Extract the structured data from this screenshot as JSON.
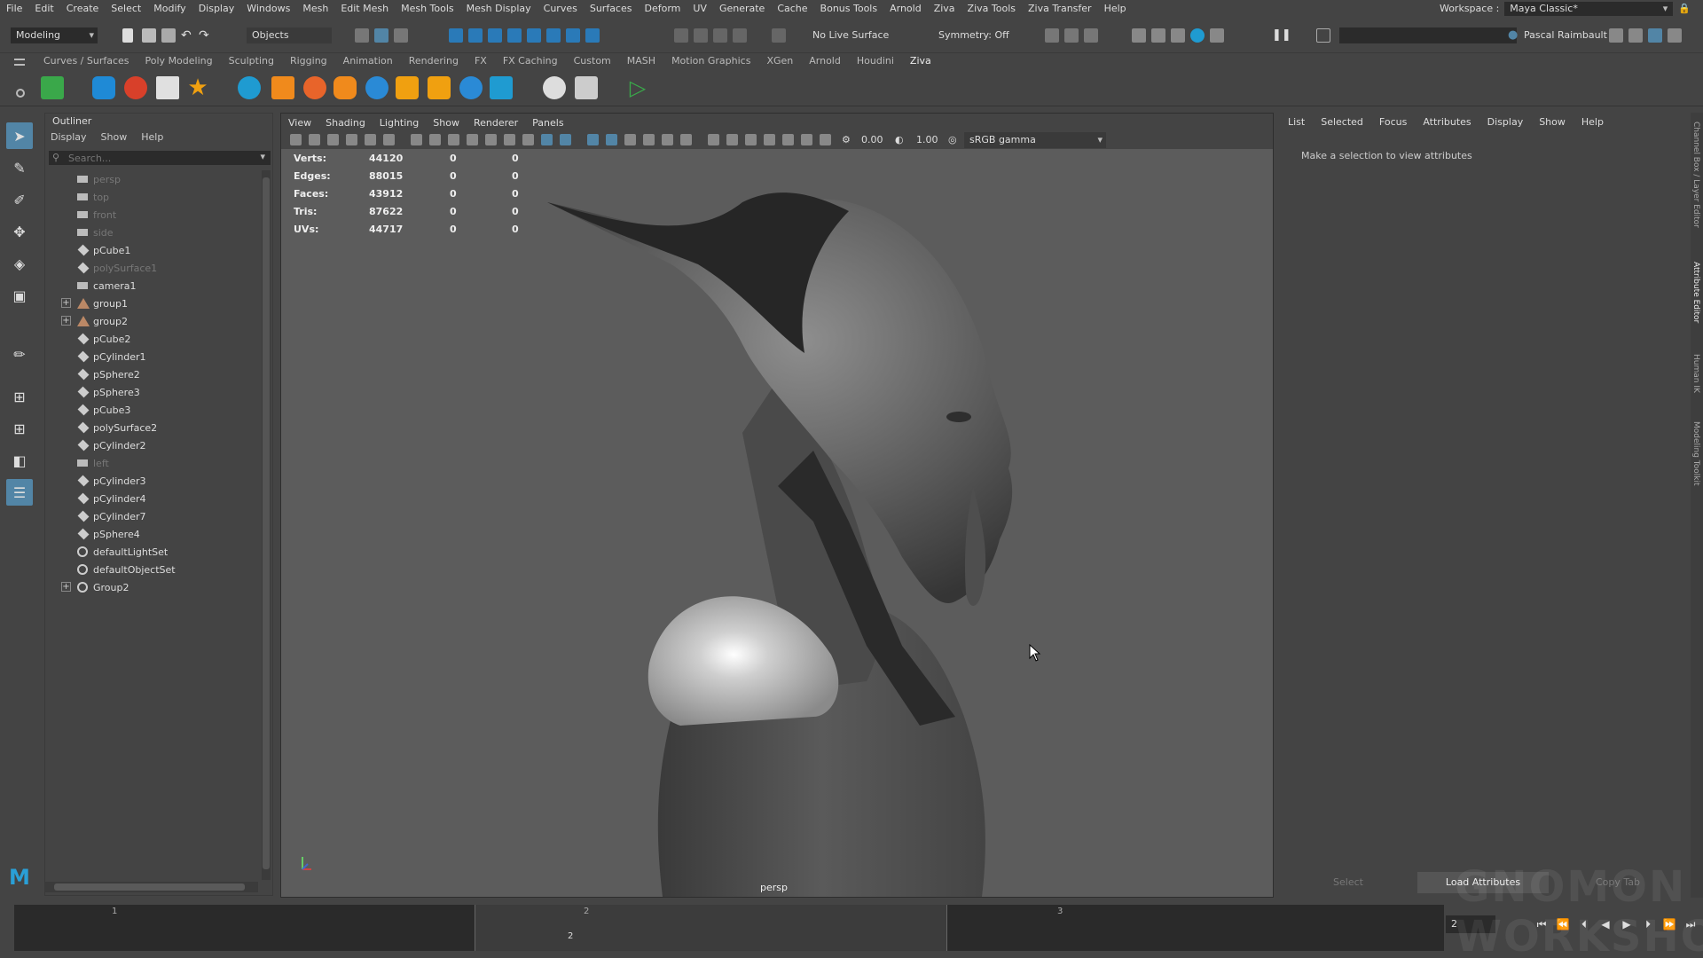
{
  "menubar": [
    "File",
    "Edit",
    "Create",
    "Select",
    "Modify",
    "Display",
    "Windows",
    "Mesh",
    "Edit Mesh",
    "Mesh Tools",
    "Mesh Display",
    "Curves",
    "Surfaces",
    "Deform",
    "UV",
    "Generate",
    "Cache",
    "Bonus Tools",
    "Arnold",
    "Ziva",
    "Ziva Tools",
    "Ziva Transfer",
    "Help"
  ],
  "workspace": {
    "label": "Workspace :",
    "value": "Maya Classic*"
  },
  "statusline": {
    "mode": "Modeling",
    "objects": "Objects",
    "live_surface": "No Live Surface",
    "symmetry": "Symmetry: Off",
    "user": "Pascal Raimbault"
  },
  "shelf_tabs": [
    "Curves / Surfaces",
    "Poly Modeling",
    "Sculpting",
    "Rigging",
    "Animation",
    "Rendering",
    "FX",
    "FX Caching",
    "Custom",
    "MASH",
    "Motion Graphics",
    "XGen",
    "Arnold",
    "Houdini",
    "Ziva"
  ],
  "active_shelf": "Ziva",
  "outliner": {
    "title": "Outliner",
    "menus": [
      "Display",
      "Show",
      "Help"
    ],
    "search_placeholder": "Search...",
    "items": [
      {
        "label": "persp",
        "icon": "camera-icon",
        "dim": true,
        "exp": false
      },
      {
        "label": "top",
        "icon": "camera-icon",
        "dim": true,
        "exp": false
      },
      {
        "label": "front",
        "icon": "camera-icon",
        "dim": true,
        "exp": false
      },
      {
        "label": "side",
        "icon": "camera-icon",
        "dim": true,
        "exp": false
      },
      {
        "label": "pCube1",
        "icon": "mesh-icon",
        "dim": false,
        "exp": false
      },
      {
        "label": "polySurface1",
        "icon": "mesh-icon",
        "dim": true,
        "exp": false
      },
      {
        "label": "camera1",
        "icon": "camera-icon",
        "dim": false,
        "exp": false
      },
      {
        "label": "group1",
        "icon": "group-icon",
        "dim": false,
        "exp": true
      },
      {
        "label": "group2",
        "icon": "group-icon",
        "dim": false,
        "exp": true
      },
      {
        "label": "pCube2",
        "icon": "mesh-icon",
        "dim": false,
        "exp": false
      },
      {
        "label": "pCylinder1",
        "icon": "mesh-icon",
        "dim": false,
        "exp": false
      },
      {
        "label": "pSphere2",
        "icon": "mesh-icon",
        "dim": false,
        "exp": false
      },
      {
        "label": "pSphere3",
        "icon": "mesh-icon",
        "dim": false,
        "exp": false
      },
      {
        "label": "pCube3",
        "icon": "mesh-icon",
        "dim": false,
        "exp": false
      },
      {
        "label": "polySurface2",
        "icon": "mesh-icon",
        "dim": false,
        "exp": false
      },
      {
        "label": "pCylinder2",
        "icon": "mesh-icon",
        "dim": false,
        "exp": false
      },
      {
        "label": "left",
        "icon": "camera-icon",
        "dim": true,
        "exp": false
      },
      {
        "label": "pCylinder3",
        "icon": "mesh-icon",
        "dim": false,
        "exp": false
      },
      {
        "label": "pCylinder4",
        "icon": "mesh-icon",
        "dim": false,
        "exp": false
      },
      {
        "label": "pCylinder7",
        "icon": "mesh-icon",
        "dim": false,
        "exp": false
      },
      {
        "label": "pSphere4",
        "icon": "mesh-icon",
        "dim": false,
        "exp": false
      },
      {
        "label": "defaultLightSet",
        "icon": "set-icon",
        "dim": false,
        "exp": false
      },
      {
        "label": "defaultObjectSet",
        "icon": "set-icon",
        "dim": false,
        "exp": false
      },
      {
        "label": "Group2",
        "icon": "set-icon",
        "dim": false,
        "exp": true
      }
    ]
  },
  "viewport": {
    "menus": [
      "View",
      "Shading",
      "Lighting",
      "Show",
      "Renderer",
      "Panels"
    ],
    "gamma": "sRGB gamma",
    "field1": "0.00",
    "field2": "1.00",
    "camera": "persp",
    "hud": [
      {
        "label": "Verts:",
        "v": "44120",
        "a": "0",
        "b": "0"
      },
      {
        "label": "Edges:",
        "v": "88015",
        "a": "0",
        "b": "0"
      },
      {
        "label": "Faces:",
        "v": "43912",
        "a": "0",
        "b": "0"
      },
      {
        "label": "Tris:",
        "v": "87622",
        "a": "0",
        "b": "0"
      },
      {
        "label": "UVs:",
        "v": "44717",
        "a": "0",
        "b": "0"
      }
    ]
  },
  "attribute_editor": {
    "menus": [
      "List",
      "Selected",
      "Focus",
      "Attributes",
      "Display",
      "Show",
      "Help"
    ],
    "message": "Make a selection to view attributes",
    "buttons": [
      "Select",
      "Load Attributes",
      "Copy Tab"
    ]
  },
  "side_tabs": [
    "Channel Box / Layer Editor",
    "Attribute Editor",
    "Human IK",
    "Modeling Toolkit"
  ],
  "timeslider": {
    "ticks": [
      "1",
      "2",
      "3"
    ],
    "range_label": "2",
    "current_frame": "2"
  },
  "watermark": "GNOMON WORKSHOP",
  "colors": {
    "accent": "#5285a6",
    "shelf_blue": "#2a8ad6",
    "shelf_orange": "#f08a1c",
    "shelf_red": "#d8402a",
    "shelf_green": "#3aa84a"
  }
}
